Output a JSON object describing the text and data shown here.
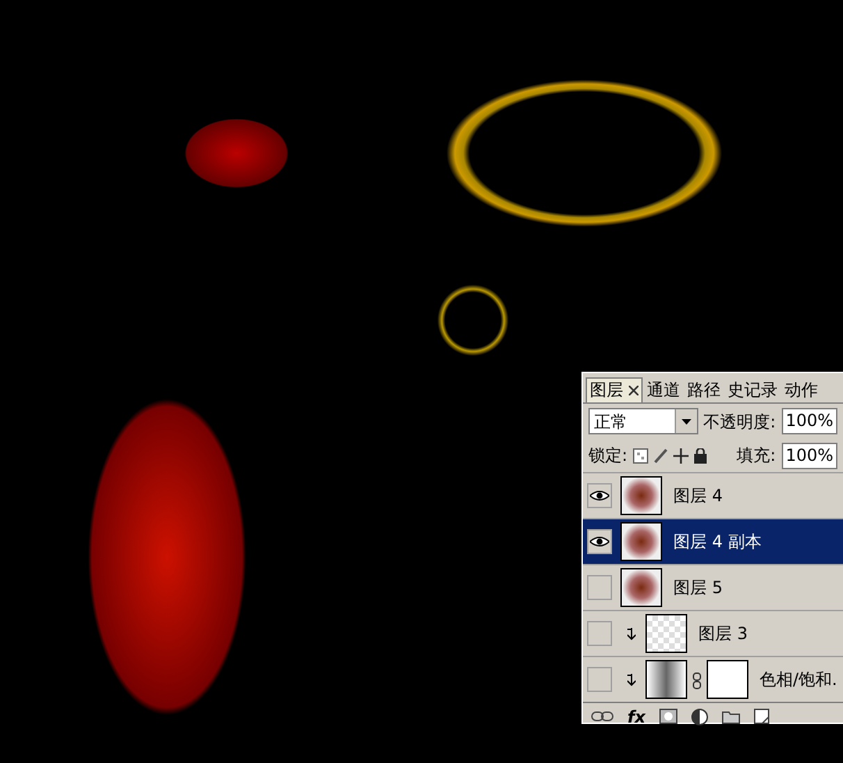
{
  "layers_panel": {
    "tabs": [
      {
        "label": "图层",
        "selected": true,
        "closable": true
      },
      {
        "label": "通道",
        "selected": false,
        "closable": false
      },
      {
        "label": "路径",
        "selected": false,
        "closable": false
      },
      {
        "label": "史记录",
        "selected": false,
        "closable": false
      },
      {
        "label": "动作",
        "selected": false,
        "closable": false
      }
    ],
    "blend_mode": "正常",
    "opacity_label": "不透明度:",
    "opacity": "100%",
    "lock_label": "锁定:",
    "fill_label": "填充:",
    "fill": "100%",
    "layers": [
      {
        "name": "图层 4",
        "kind": "image",
        "visible": true,
        "selected": false,
        "clipped": false
      },
      {
        "name": "图层 4 副本",
        "kind": "image",
        "visible": true,
        "selected": true,
        "clipped": false
      },
      {
        "name": "图层 5",
        "kind": "image",
        "visible": false,
        "selected": false,
        "clipped": false
      },
      {
        "name": "图层 3",
        "kind": "empty",
        "visible": false,
        "selected": false,
        "clipped": true
      },
      {
        "name": "色相/饱和.",
        "kind": "adjustment",
        "visible": false,
        "selected": false,
        "clipped": true
      }
    ],
    "footer_fx": "fx"
  }
}
